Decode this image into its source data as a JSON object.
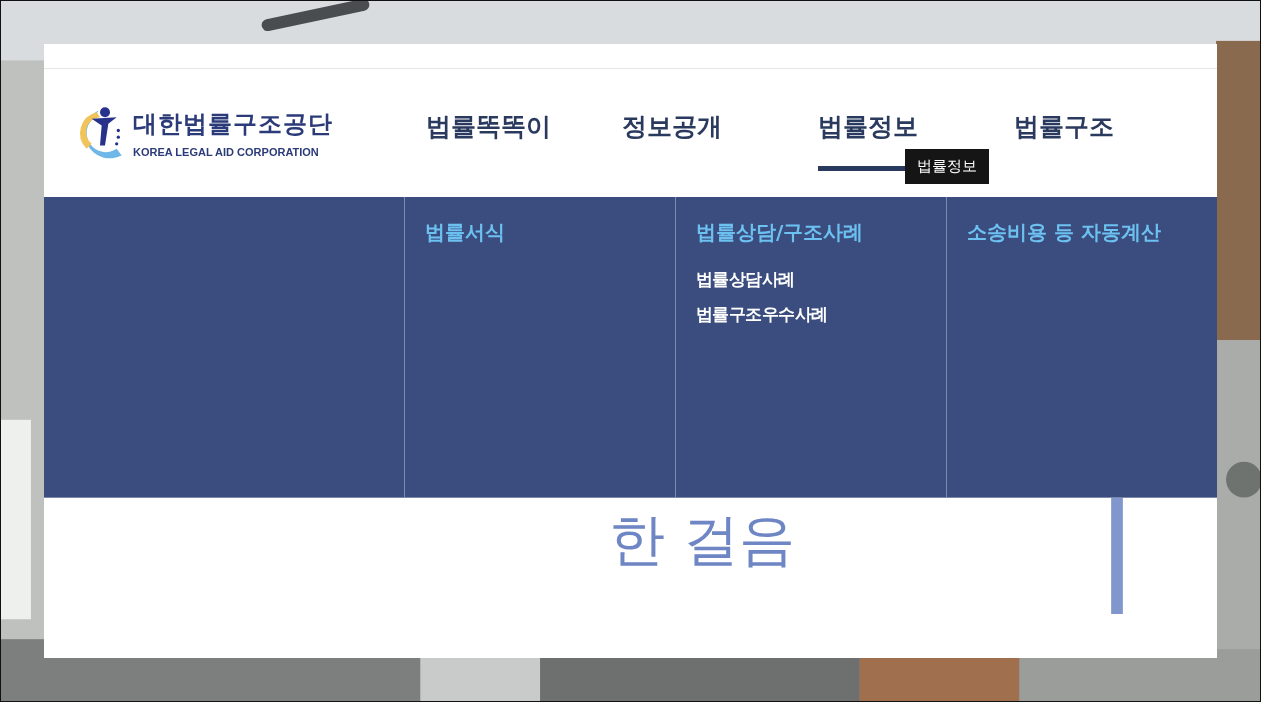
{
  "logo": {
    "name_ko": "대한법률구조공단",
    "name_en": "KOREA LEGAL AID CORPORATION"
  },
  "nav": [
    {
      "label": "법률똑똑이",
      "selected": false
    },
    {
      "label": "정보공개",
      "selected": false
    },
    {
      "label": "법률정보",
      "selected": true
    },
    {
      "label": "법률구조",
      "selected": false
    }
  ],
  "tooltip": "법률정보",
  "dropdown": {
    "columns": [
      {
        "title": "법률서식"
      },
      {
        "title": "법률상담/구조사례",
        "links": [
          "법률상담사례",
          "법률구조우수사례"
        ]
      },
      {
        "title": "소송비용 등 자동계산"
      }
    ]
  },
  "banner": {
    "line_1": "한 걸음"
  }
}
